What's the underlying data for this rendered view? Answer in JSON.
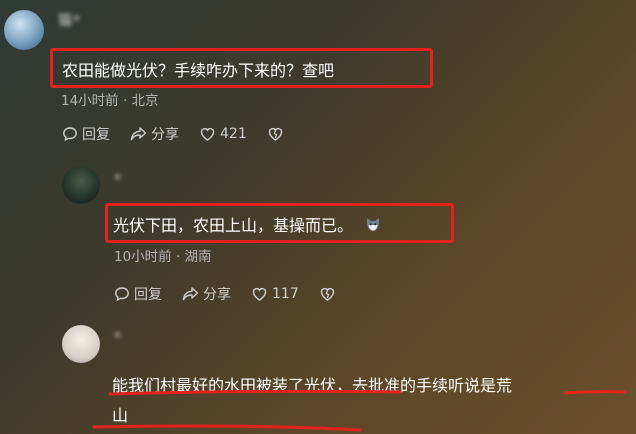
{
  "comments": [
    {
      "username": "猫*",
      "text": "农田能做光伏？手续咋办下来的？查吧",
      "meta": "14小时前 · 北京",
      "actions": {
        "reply": "回复",
        "share": "分享",
        "likes": "421"
      }
    },
    {
      "username": "*",
      "text": "光伏下田，农田上山，基操而已。",
      "meta": "10小时前 · 湖南",
      "actions": {
        "reply": "回复",
        "share": "分享",
        "likes": "117"
      }
    },
    {
      "username": "*",
      "text_line1": "能我们村最好的水田被装了光伏，去批准的手续听说是荒",
      "text_line2": "山"
    }
  ],
  "colors": {
    "highlight": "#e3221d",
    "meta": "#b5b5b5",
    "text": "#ffffff"
  },
  "icons": [
    "comment-icon",
    "share-icon",
    "heart-icon",
    "broken-heart-icon",
    "cat-emoji-icon"
  ]
}
